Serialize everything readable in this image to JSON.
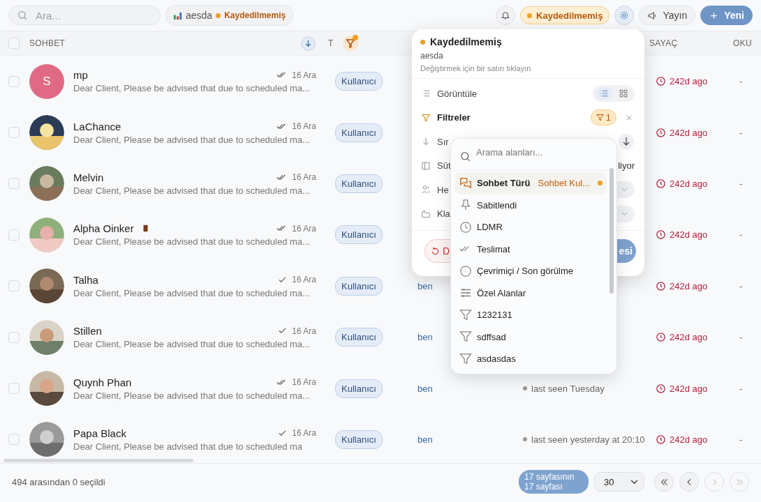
{
  "topbar": {
    "search": {
      "placeholder": "Ara..."
    },
    "view_chip": {
      "name": "aesda",
      "status": "Kaydedilmemiş"
    },
    "status_badge": "Kaydedilmemiş",
    "buttons": [
      {
        "label": "Yayın",
        "kind": "secondary"
      },
      {
        "label": "Yeni",
        "kind": "primary"
      }
    ]
  },
  "table": {
    "header_checked": false,
    "columns": [
      {
        "label": "SOHBET",
        "kind": "chat"
      },
      {
        "label": "T",
        "kind": "type"
      },
      {
        "label": "SAYAÇ",
        "kind": "counter"
      },
      {
        "label": "OKU",
        "kind": "read"
      }
    ],
    "rows": [
      {
        "name": "mp",
        "avatar": {
          "kind": "letter",
          "letter": "S"
        },
        "double_check": true,
        "date": "16 Ara",
        "message": "Dear Client, Please be advised that due to scheduled ma...",
        "flag": false,
        "type": "Kullanıcı",
        "counter": "242d ago",
        "read": "-",
        "checked": false
      },
      {
        "name": "LaChance",
        "double_check": true,
        "date": "16 Ara",
        "message": "Dear Client, Please be advised that due to scheduled ma...",
        "flag": false,
        "type": "Kullanıcı",
        "counter": "242d ago",
        "read": "-",
        "checked": false
      },
      {
        "name": "Melvin",
        "double_check": true,
        "date": "16 Ara",
        "message": "Dear Client, Please be advised that due to scheduled ma...",
        "flag": false,
        "type": "Kullanıcı",
        "counter": "242d ago",
        "read": "-",
        "checked": false
      },
      {
        "name": "Alpha Oinker",
        "double_check": true,
        "date": "16 Ara",
        "message": "Dear Client, Please be advised that due to scheduled ma...",
        "flag": true,
        "type": "Kullanıcı",
        "counter": "242d ago",
        "read": "-",
        "checked": false
      },
      {
        "name": "Talha",
        "double_check": false,
        "date": "16 Ara",
        "message": "Dear Client, Please be advised that due to scheduled ma...",
        "flag": false,
        "type": "Kullanıcı",
        "agent": "ben",
        "counter": "242d ago",
        "read": "-",
        "checked": false
      },
      {
        "name": "Stillen",
        "double_check": false,
        "date": "16 Ara",
        "message": "Dear Client, Please be advised that due to scheduled ma...",
        "flag": false,
        "type": "Kullanıcı",
        "agent": "ben",
        "counter": "242d ago",
        "read": "-",
        "checked": false
      },
      {
        "name": "Quynh Phan",
        "double_check": true,
        "date": "16 Ara",
        "message": "Dear Client, Please be advised that due to scheduled ma...",
        "flag": false,
        "type": "Kullanıcı",
        "agent": "ben",
        "last_seen": "last seen Tuesday",
        "counter": "242d ago",
        "read": "-",
        "checked": false
      },
      {
        "name": "Papa Black",
        "double_check": false,
        "date": "16 Ara",
        "message": "Dear Client, Please be advised that due to scheduled ma",
        "flag": false,
        "type": "Kullanıcı",
        "agent": "ben",
        "last_seen": "last seen yesterday at 20:10",
        "counter": "242d ago",
        "read": "-",
        "checked": false
      }
    ]
  },
  "popover": {
    "title": "Kaydedilmemiş",
    "view_name": "aesda",
    "hint": "Değiştirmek için bir satırı tıklayın",
    "rows": [
      {
        "kind": "display",
        "label": "Görüntüle",
        "options": [
          {
            "kind": "list",
            "selected": true
          },
          {
            "kind": "grid",
            "selected": false
          }
        ]
      },
      {
        "kind": "filters",
        "label": "Filtreler",
        "count": "1"
      },
      {
        "kind": "sort",
        "label": "Sır"
      },
      {
        "kind": "columns",
        "label": "Süt",
        "value": "liyor"
      },
      {
        "kind": "accounts",
        "label": "He"
      },
      {
        "kind": "folders",
        "label": "Kla"
      }
    ],
    "reset": "D",
    "apply": "esi"
  },
  "field_menu": {
    "placeholder": "Arama alanları...",
    "items": [
      {
        "kind": "chat",
        "label": "Sohbet Türü",
        "value": "Sohbet Kul...",
        "selected": true
      },
      {
        "kind": "pin",
        "label": "Sabitlendi",
        "selected": false
      },
      {
        "kind": "clock",
        "label": "LDMR",
        "selected": false
      },
      {
        "kind": "delivery",
        "label": "Teslimat",
        "selected": false
      },
      {
        "kind": "presence",
        "label": "Çevrimiçi / Son görülme",
        "selected": false
      },
      {
        "kind": "custom",
        "label": "Özel Alanlar",
        "selected": false
      },
      {
        "kind": "filter",
        "label": "1232131",
        "selected": false
      },
      {
        "kind": "filter",
        "label": "sdffsad",
        "selected": false
      },
      {
        "kind": "filter",
        "label": "asdasdas",
        "selected": false
      }
    ]
  },
  "footer": {
    "selection": "494 arasından 0 seçildi",
    "page_info": "17 sayfasının 17 sayfası",
    "page_size": "30",
    "nav": [
      {
        "kind": "first",
        "disabled": false
      },
      {
        "kind": "prev",
        "disabled": false
      },
      {
        "kind": "next",
        "disabled": true
      },
      {
        "kind": "last",
        "disabled": true
      }
    ]
  }
}
